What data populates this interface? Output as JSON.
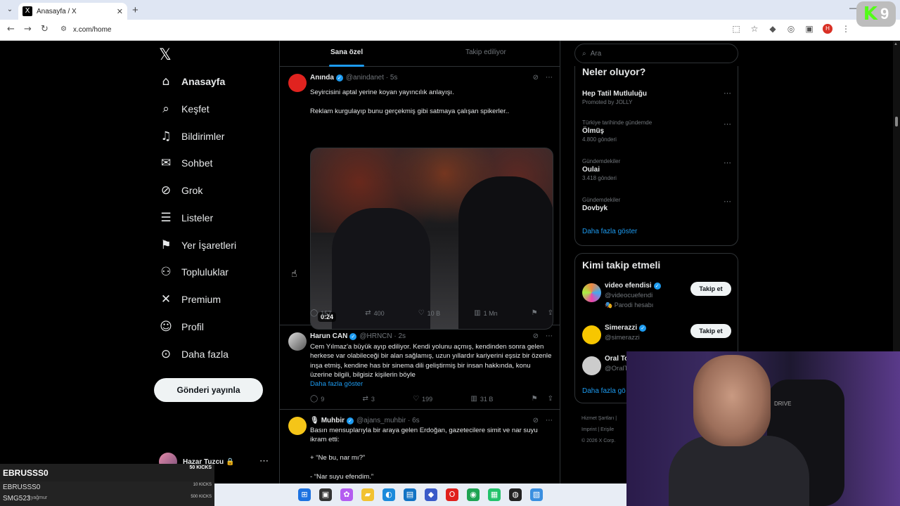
{
  "browser": {
    "tab_title": "Anasayfa / X",
    "tab_favicon": "X",
    "new_tab": "+",
    "url": "x.com/home",
    "win_min": "—",
    "profile_initial": "H"
  },
  "stream_badge": {
    "k": "K",
    "n": "9"
  },
  "nav": {
    "logo": "𝕏",
    "items": [
      {
        "label": "Anasayfa",
        "icon": "home-icon",
        "glyph": "⌂"
      },
      {
        "label": "Keşfet",
        "icon": "search-icon",
        "glyph": "⌕"
      },
      {
        "label": "Bildirimler",
        "icon": "bell-icon",
        "glyph": "♫"
      },
      {
        "label": "Sohbet",
        "icon": "mail-icon",
        "glyph": "✉"
      },
      {
        "label": "Grok",
        "icon": "grok-icon",
        "glyph": "⊘"
      },
      {
        "label": "Listeler",
        "icon": "list-icon",
        "glyph": "☰"
      },
      {
        "label": "Yer İşaretleri",
        "icon": "bookmark-icon",
        "glyph": "⚑"
      },
      {
        "label": "Topluluklar",
        "icon": "communities-icon",
        "glyph": "⚇"
      },
      {
        "label": "Premium",
        "icon": "x-premium-icon",
        "glyph": "✕"
      },
      {
        "label": "Profil",
        "icon": "profile-icon",
        "glyph": "☺"
      },
      {
        "label": "Daha fazla",
        "icon": "more-circle-icon",
        "glyph": "⊙"
      }
    ],
    "post_button": "Gönderi yayınla",
    "account_name": "Hazar Tuzcu",
    "account_lock": "🔒"
  },
  "feed": {
    "tabs": [
      {
        "label": "Sana özel"
      },
      {
        "label": "Takip ediliyor"
      }
    ],
    "posts": [
      {
        "name": "Anında",
        "handle": "@anindanet · 5s",
        "text1": "Seyircisini aptal yerine koyan yayıncılık anlayışı.",
        "text2": "Reklam kurgulayıp bunu gerçekmiş gibi satmaya çalışan spikerler..",
        "duration": "0:24",
        "replies": "157",
        "reposts": "400",
        "likes": "10 B",
        "views": "1 Mn"
      },
      {
        "name": "Harun CAN",
        "handle": "@HRNCN · 2s",
        "text": "Cem Yılmaz'a büyük ayıp ediliyor. Kendi yolunu açmış, kendinden sonra gelen herkese var olabileceği bir alan sağlamış, uzun yıllardır kariyerini eşsiz bir özenle inşa etmiş, kendine has bir sinema dili geliştirmiş bir insan hakkında, konu üzerine bilgili, bilgisiz kişilerin böyle",
        "show_more": "Daha fazla göster",
        "replies": "9",
        "reposts": "3",
        "likes": "199",
        "views": "31 B"
      },
      {
        "name": "Muhbir",
        "handle": "@ajans_muhbir · 6s",
        "text1": "Basın mensuplarıyla bir araya gelen Erdoğan, gazetecilere simit ve nar suyu ikram etti:",
        "text2": "+ “Ne bu, nar mı?”",
        "text3": "- “Nar suyu efendim.”"
      }
    ]
  },
  "right": {
    "search_placeholder": "Ara",
    "trends_title": "Neler oluyor?",
    "trends": [
      {
        "context": "",
        "name": "Hep Tatil Mutluluğu",
        "count": "Promoted by JOLLY"
      },
      {
        "context": "Türkiye tarihinde gündemde",
        "name": "Ölmüş",
        "count": "4.800 gönderi"
      },
      {
        "context": "Gündemdekiler",
        "name": "Oulai",
        "count": "3.418 gönderi"
      },
      {
        "context": "Gündemdekiler",
        "name": "Dovbyk",
        "count": ""
      }
    ],
    "trends_more": "Daha fazla göster",
    "follow_title": "Kimi takip etmeli",
    "follow": [
      {
        "name": "video efendisi",
        "handle": "@videocuefendi",
        "sub": "Parodi hesabı",
        "button": "Takip et"
      },
      {
        "name": "Simerazzi",
        "handle": "@simerazzi",
        "sub": "",
        "button": "Takip et"
      },
      {
        "name": "Oral To",
        "handle": "@OralT",
        "sub": "",
        "button": ""
      }
    ],
    "follow_more": "Daha fazla gö",
    "footer1": "Hizmet Şartları  |",
    "footer2": "Imprint  |  Erişile",
    "footer3": "© 2026 X Corp."
  },
  "webcam": {
    "chair_brand": "DRIVE"
  },
  "chat": {
    "row1_name": "EBRUSSS0",
    "row1_kicks": "50 KICKS",
    "row2_name": "EBRUSSS0",
    "row2_kicks": "10 KICKS",
    "row3_name": "SMG523",
    "row3_sub": "f yağmur",
    "row3_kicks": "500 KICKS"
  },
  "colors": {
    "accent": "#1d9bf0",
    "background": "#000000",
    "border": "#2f3336",
    "muted": "#71767b"
  }
}
